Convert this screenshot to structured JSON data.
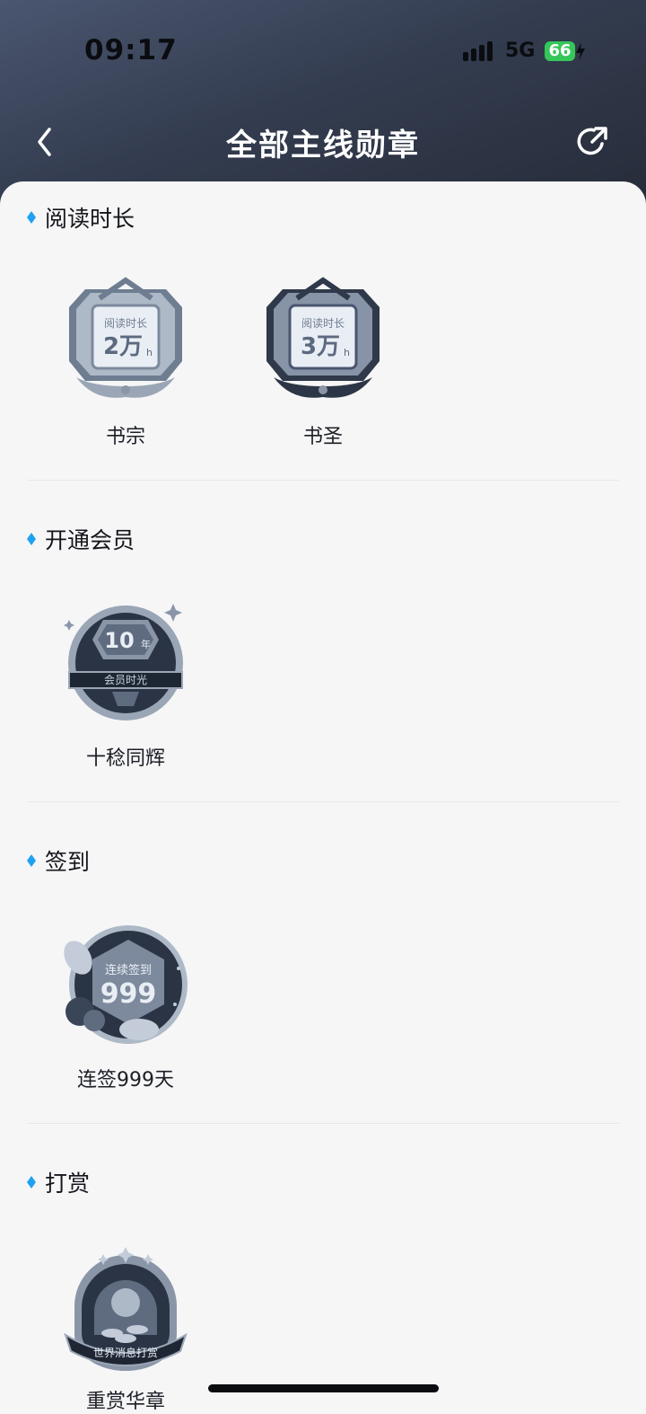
{
  "status": {
    "time": "09:17",
    "network": "5G",
    "battery": "66"
  },
  "nav": {
    "title": "全部主线勋章",
    "back_icon": "chevron-left-icon",
    "share_icon": "refresh-share-icon"
  },
  "colors": {
    "accent": "#1fa1f2",
    "header_dark": "#343d50",
    "badge_gray": "#8a96a8"
  },
  "sections": [
    {
      "title": "阅读时长",
      "badges": [
        {
          "name": "书宗",
          "label": "阅读时长",
          "value": "2万",
          "unit": "h"
        },
        {
          "name": "书圣",
          "label": "阅读时长",
          "value": "3万",
          "unit": "h"
        }
      ]
    },
    {
      "title": "开通会员",
      "badges": [
        {
          "name": "十稔同辉",
          "value": "10",
          "unit": "年",
          "label": "会员时光"
        }
      ]
    },
    {
      "title": "签到",
      "badges": [
        {
          "name": "连签999天",
          "label": "连续签到",
          "value": "999"
        }
      ]
    },
    {
      "title": "打赏",
      "badges": [
        {
          "name": "重赏华章",
          "label": "世界消息打赏"
        }
      ]
    }
  ]
}
